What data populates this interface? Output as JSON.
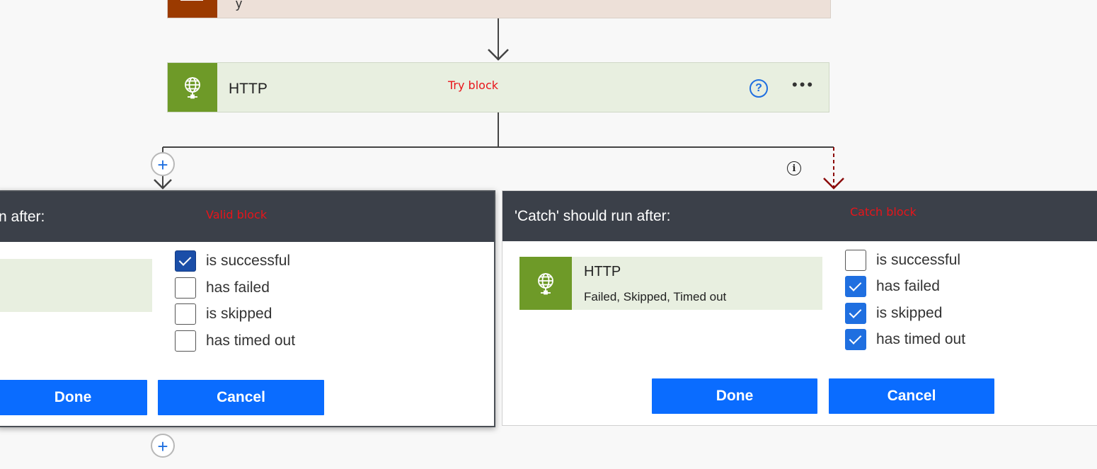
{
  "top_card": {
    "partial_text": "y"
  },
  "http_card": {
    "title": "HTTP",
    "annotation": "Try block",
    "help_glyph": "?",
    "more_glyph": "•••"
  },
  "left_panel": {
    "title": "n after:",
    "annotation": "Valid block",
    "options": [
      {
        "label": "is successful",
        "checked": true
      },
      {
        "label": "has failed",
        "checked": false
      },
      {
        "label": "is skipped",
        "checked": false
      },
      {
        "label": "has timed out",
        "checked": false
      }
    ],
    "done_label": "Done",
    "cancel_label": "Cancel"
  },
  "right_panel": {
    "title": "'Catch' should run after:",
    "annotation": "Catch block",
    "action_card": {
      "title": "HTTP",
      "status": "Failed, Skipped, Timed out"
    },
    "options": [
      {
        "label": "is successful",
        "checked": false
      },
      {
        "label": "has failed",
        "checked": true
      },
      {
        "label": "is skipped",
        "checked": true
      },
      {
        "label": "has timed out",
        "checked": true
      }
    ],
    "done_label": "Done",
    "cancel_label": "Cancel"
  },
  "plus_glyph": "+",
  "info_glyph": "i",
  "colors": {
    "accent": "#0a6cff",
    "panel_header": "#3b4049",
    "action_green": "#6e9a28",
    "card_green_bg": "#e8efe0",
    "annotation_red": "#e8141a",
    "run_after_dashed": "#8b0a0a"
  },
  "icons": {
    "action_icon": "globe-icon",
    "help": "help-circle-icon",
    "more": "more-horizontal-icon",
    "info": "info-icon",
    "add": "plus-circle-icon"
  }
}
